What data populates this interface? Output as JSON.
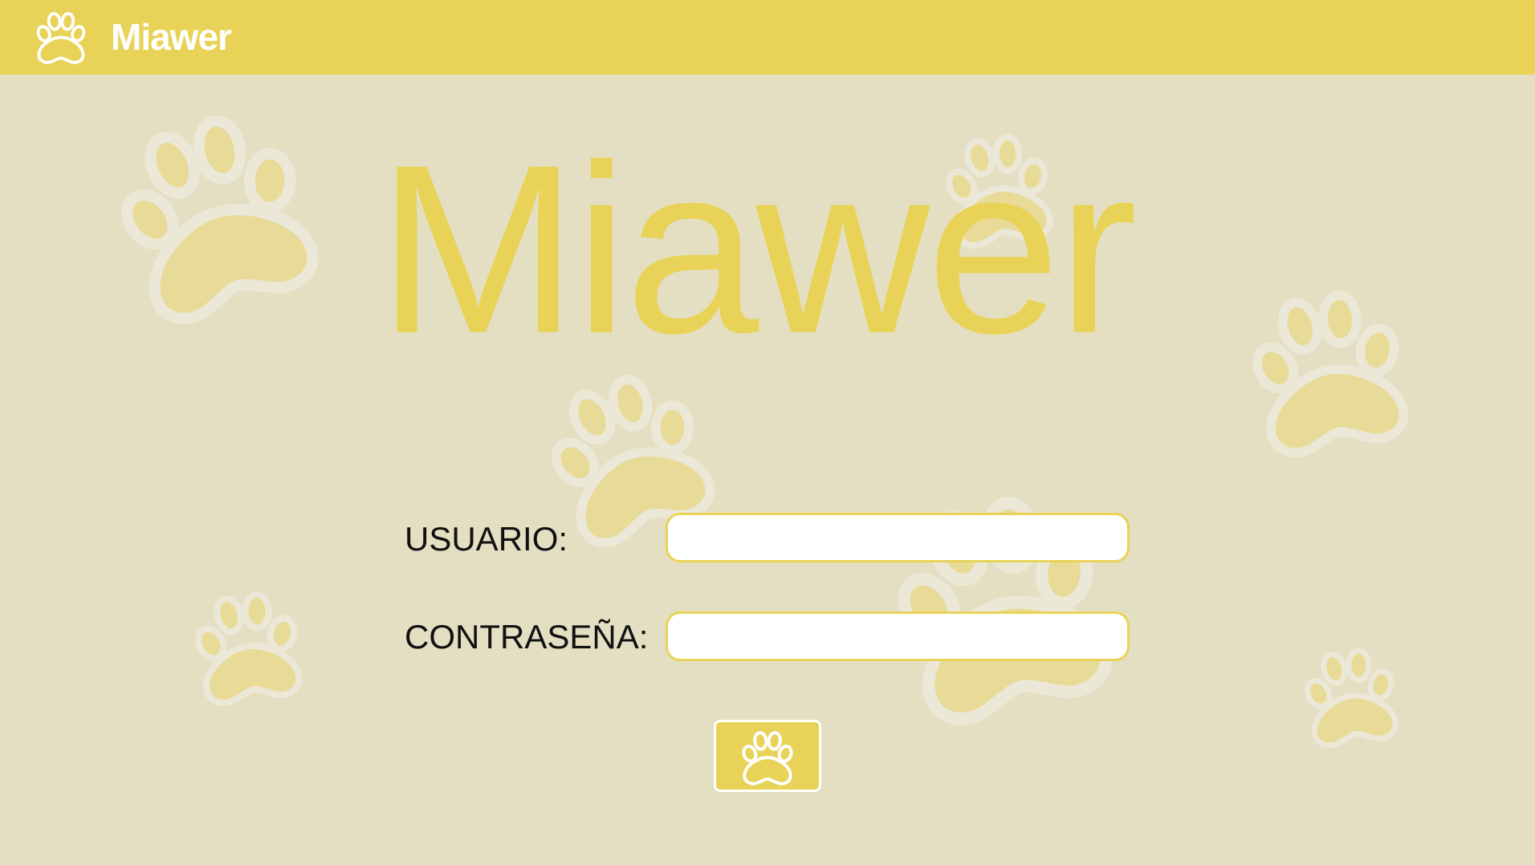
{
  "header": {
    "app_name": "Miawer",
    "logo_icon": "paw-icon"
  },
  "hero": {
    "title": "Miawer"
  },
  "login_form": {
    "username_label": "USUARIO:",
    "username_value": "",
    "password_label": "CONTRASEÑA:",
    "password_value": "",
    "submit_icon": "paw-icon"
  },
  "colors": {
    "accent": "#e8d358",
    "background": "#e4dfc2",
    "paw_fill": "#e8da97",
    "paw_outline": "#ece8d8",
    "text": "#111111"
  }
}
